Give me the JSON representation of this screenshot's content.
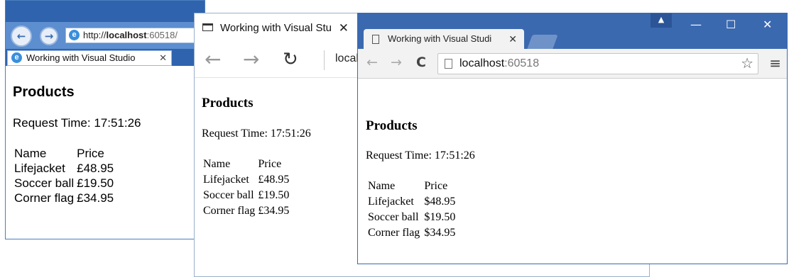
{
  "ie": {
    "address": {
      "protocol": "http://",
      "host": "localhost",
      "port": ":60518/"
    },
    "tab_title": "Working with Visual Studio",
    "close": "✕",
    "page": {
      "heading": "Products",
      "request_time": "Request Time: 17:51:26",
      "columns": [
        "Name",
        "Price"
      ],
      "rows": [
        [
          "Lifejacket",
          "£48.95"
        ],
        [
          "Soccer ball",
          "£19.50"
        ],
        [
          "Corner flag",
          "£34.95"
        ]
      ]
    }
  },
  "edge": {
    "tab_title": "Working with Visual Stu",
    "close": "✕",
    "address": "local",
    "page": {
      "heading": "Products",
      "request_time": "Request Time: 17:51:26",
      "columns": [
        "Name",
        "Price"
      ],
      "rows": [
        [
          "Lifejacket",
          "£48.95"
        ],
        [
          "Soccer ball",
          "£19.50"
        ],
        [
          "Corner flag",
          "£34.95"
        ]
      ]
    }
  },
  "chrome": {
    "tab_title": "Working with Visual Studi",
    "close": "✕",
    "address": {
      "host": "localhost",
      "port": ":60518"
    },
    "page": {
      "heading": "Products",
      "request_time": "Request Time: 17:51:26",
      "columns": [
        "Name",
        "Price"
      ],
      "rows": [
        [
          "Lifejacket",
          "$48.95"
        ],
        [
          "Soccer ball",
          "$19.50"
        ],
        [
          "Corner flag",
          "$34.95"
        ]
      ]
    }
  },
  "icons": {
    "back": "←",
    "forward": "→",
    "refresh": "↻",
    "reload": "C",
    "minimize": "—",
    "maximize": "☐",
    "close": "✕",
    "star": "☆",
    "menu": "≡",
    "ie_logo": "e",
    "user": "▲"
  },
  "colors": {
    "ie_frame": "#2f63ad",
    "chrome_frame": "#3b69b0",
    "edge_tabbar": "#f2f2f2"
  }
}
